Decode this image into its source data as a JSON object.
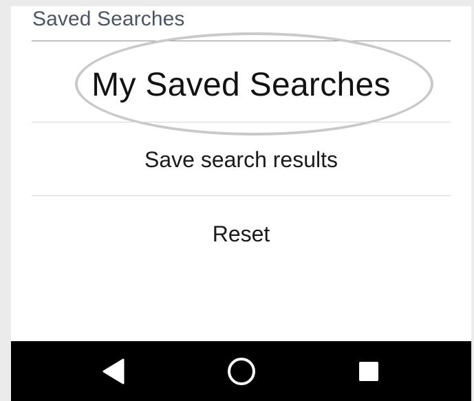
{
  "header": {
    "title": "Saved Searches"
  },
  "menu": {
    "items": [
      {
        "label": "My Saved Searches",
        "highlighted": true
      },
      {
        "label": "Save search results"
      },
      {
        "label": "Reset"
      }
    ]
  },
  "navbar": {
    "buttons": [
      {
        "icon": "back-triangle-icon"
      },
      {
        "icon": "home-circle-icon"
      },
      {
        "icon": "recents-square-icon"
      }
    ]
  },
  "colors": {
    "background": "#ebebeb",
    "sheet": "#ffffff",
    "title_text": "#4c5560",
    "item_text": "#1a1a1a",
    "highlight_oval": "#c9c9c9",
    "navbar": "#000000",
    "nav_icon": "#ffffff"
  }
}
